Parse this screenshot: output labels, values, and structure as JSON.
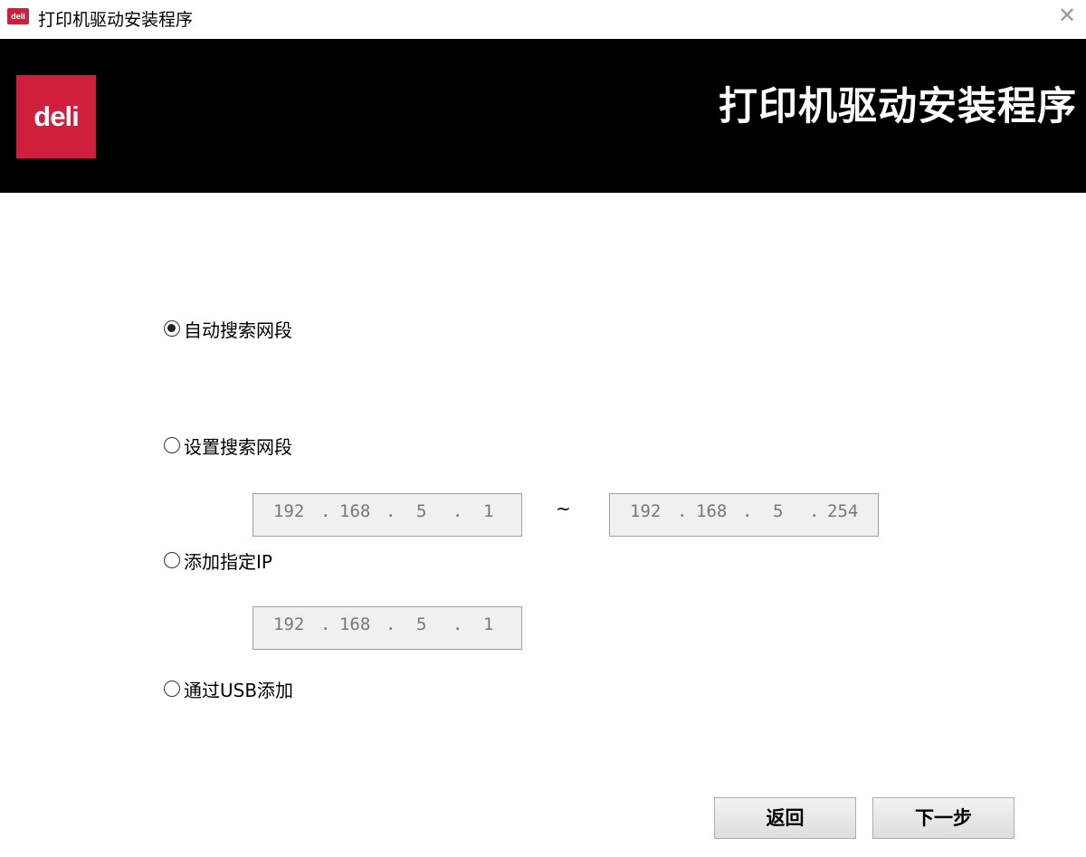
{
  "window": {
    "title": "打印机驱动安装程序",
    "icon_text": "deli"
  },
  "banner": {
    "logo_text": "deli",
    "title": "打印机驱动安装程序"
  },
  "options": {
    "auto": {
      "label": "自动搜索网段",
      "selected": true
    },
    "range": {
      "label": "设置搜索网段",
      "selected": false,
      "start": [
        "192",
        "168",
        "5",
        "1"
      ],
      "end": [
        "192",
        "168",
        "5",
        "254"
      ],
      "separator": "~"
    },
    "ip": {
      "label": "添加指定IP",
      "selected": false,
      "value": [
        "192",
        "168",
        "5",
        "1"
      ]
    },
    "usb": {
      "label": "通过USB添加",
      "selected": false
    }
  },
  "ip_dot": ".",
  "buttons": {
    "back": "返回",
    "next": "下一步"
  },
  "colors": {
    "brand": "#d01f3c",
    "banner_bg": "#000000"
  }
}
